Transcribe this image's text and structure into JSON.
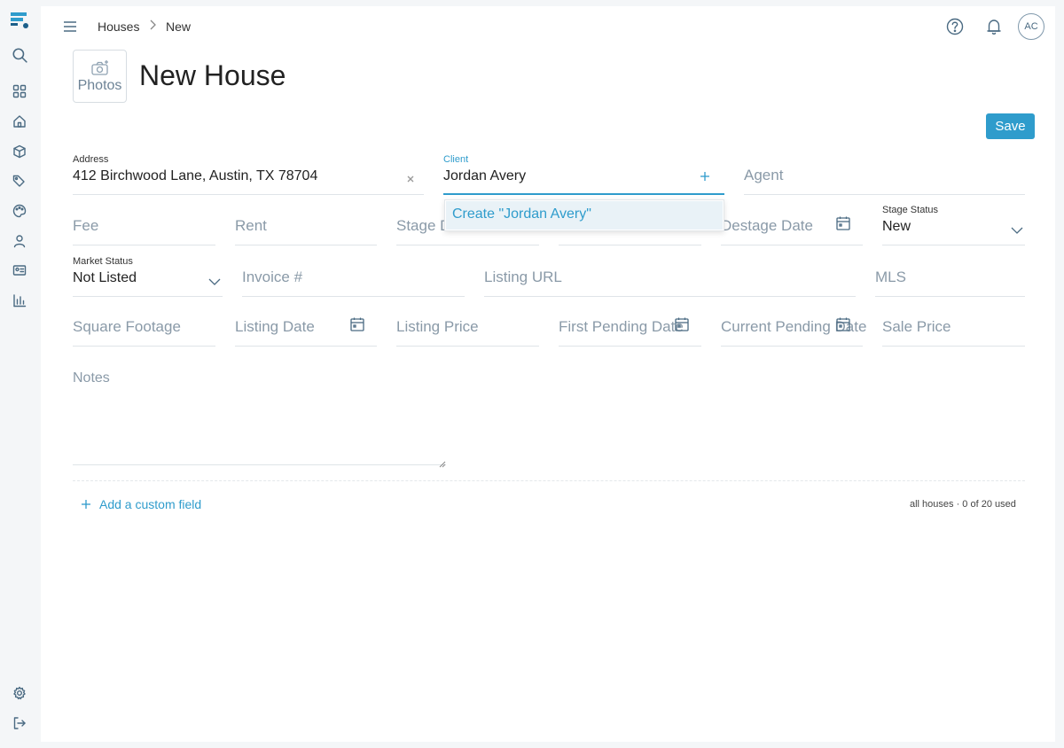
{
  "breadcrumb": {
    "parent": "Houses",
    "current": "New"
  },
  "user": {
    "initials": "AC"
  },
  "photos_label": "Photos",
  "page_title": "New House",
  "save_label": "Save",
  "form": {
    "address": {
      "label": "Address",
      "value": "412 Birchwood Lane, Austin, TX 78704"
    },
    "client": {
      "label": "Client",
      "value": "Jordan Avery"
    },
    "client_suggestion": "Create \"Jordan Avery\"",
    "agent": {
      "placeholder": "Agent"
    },
    "fee": {
      "placeholder": "Fee"
    },
    "rent": {
      "placeholder": "Rent"
    },
    "stage_date": {
      "placeholder": "Stage Date"
    },
    "destage_date": {
      "placeholder": "Destage Date"
    },
    "stage_status": {
      "label": "Stage Status",
      "value": "New"
    },
    "market_status": {
      "label": "Market Status",
      "value": "Not Listed"
    },
    "invoice": {
      "placeholder": "Invoice #"
    },
    "listing_url": {
      "placeholder": "Listing URL"
    },
    "mls": {
      "placeholder": "MLS"
    },
    "square_footage": {
      "placeholder": "Square Footage"
    },
    "listing_date": {
      "placeholder": "Listing Date"
    },
    "listing_price": {
      "placeholder": "Listing Price"
    },
    "first_pending_date": {
      "placeholder": "First Pending Date"
    },
    "current_pending_date": {
      "placeholder": "Current Pending Date"
    },
    "sale_price": {
      "placeholder": "Sale Price"
    },
    "notes": {
      "placeholder": "Notes"
    }
  },
  "add_custom_field": "Add a custom field",
  "usage_text": "all houses · 0 of 20 used",
  "colors": {
    "accent": "#2f9ccc",
    "icon": "#4a6a82",
    "placeholder": "#8a9aa8"
  }
}
